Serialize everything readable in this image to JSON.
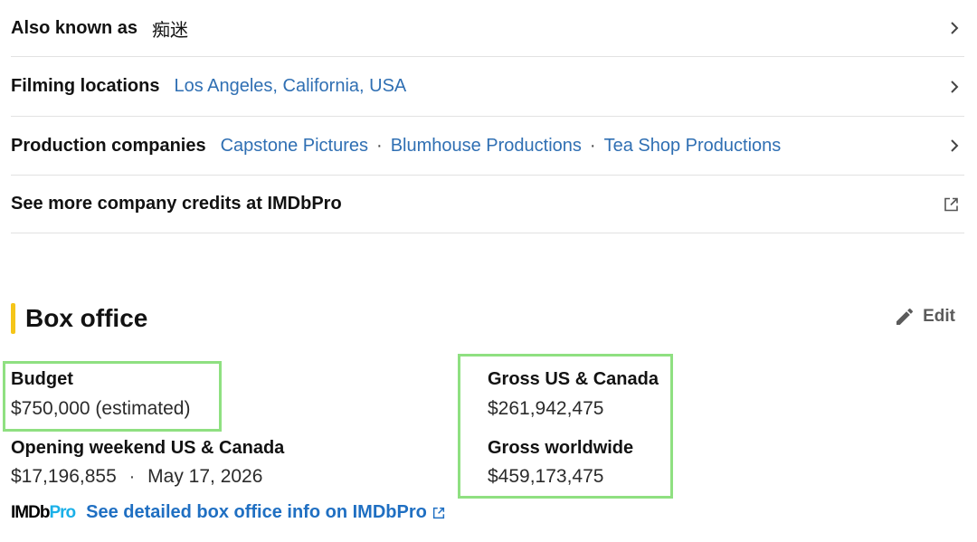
{
  "details": {
    "aka": {
      "label": "Also known as",
      "value": "痴迷"
    },
    "filming": {
      "label": "Filming locations",
      "value": "Los Angeles, California, USA"
    },
    "production": {
      "label": "Production companies",
      "companies": [
        "Capstone Pictures",
        "Blumhouse Productions",
        "Tea Shop Productions"
      ],
      "separator": "·"
    },
    "more_credits": {
      "label": "See more company credits at IMDbPro"
    }
  },
  "box_office": {
    "title": "Box office",
    "edit_label": "Edit",
    "budget": {
      "label": "Budget",
      "value": "$750,000 (estimated)"
    },
    "opening": {
      "label": "Opening weekend US & Canada",
      "amount": "$17,196,855",
      "separator": "·",
      "date": "May 17, 2026"
    },
    "gross_us": {
      "label": "Gross US & Canada",
      "value": "$261,942,475"
    },
    "gross_world": {
      "label": "Gross worldwide",
      "value": "$459,173,475"
    },
    "imdbpro": {
      "logo_imdb": "IMDb",
      "logo_pro": "Pro",
      "link": "See detailed box office info on IMDbPro"
    }
  },
  "colors": {
    "accent": "#f5c518",
    "link": "#2f6fb3",
    "highlight": "#8fe081",
    "pro": "#1ab0e8"
  },
  "icons": {
    "row_arrow": "chevron-right-icon",
    "external": "external-link-icon",
    "edit": "pencil-icon"
  }
}
